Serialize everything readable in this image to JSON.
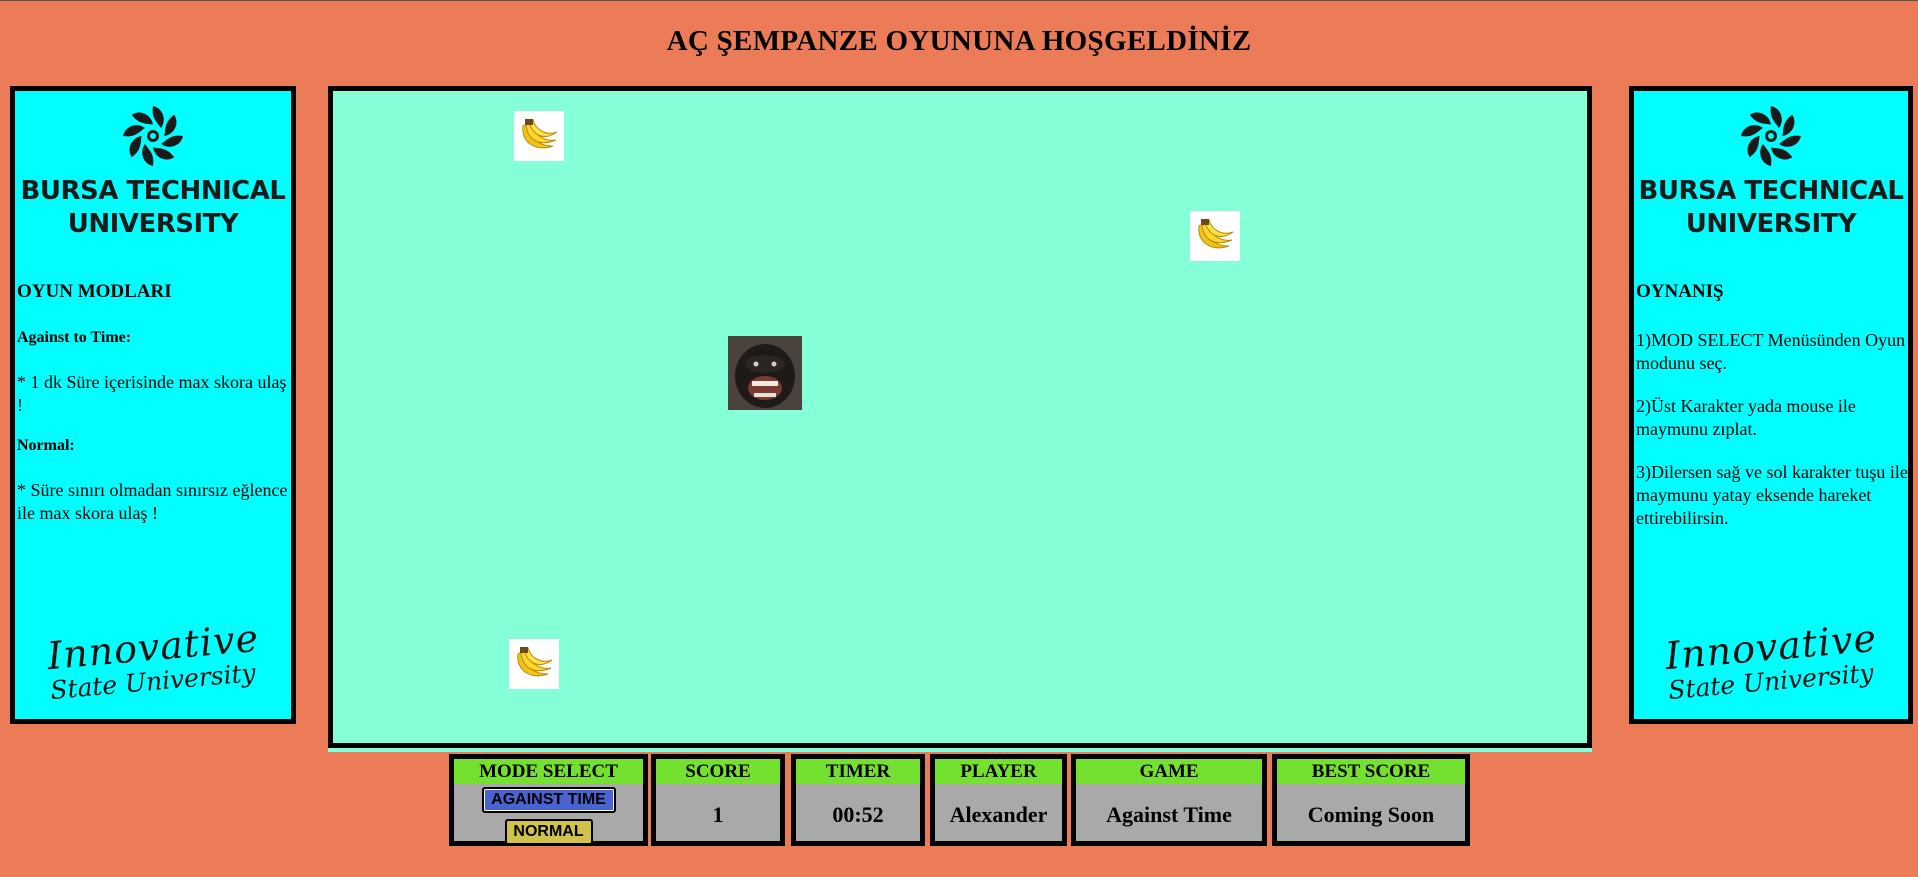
{
  "header": {
    "title": "AÇ ŞEMPANZE OYUNUNA HOŞGELDİNİZ"
  },
  "left_panel": {
    "university": "BURSA TECHNICAL UNIVERSITY",
    "heading": "OYUN MODLARI",
    "mode1_title": "Against to Time:",
    "mode1_desc": "* 1 dk Süre içerisinde max skora ulaş !",
    "mode2_title": "Normal:",
    "mode2_desc": "* Süre sınırı olmadan sınırsız eğlence ile max skora ulaş !",
    "motto_line1": "Innovative",
    "motto_line2": "State University"
  },
  "right_panel": {
    "university": "BURSA TECHNICAL UNIVERSITY",
    "heading": "OYNANIŞ",
    "step1": "1)MOD SELECT Menüsünden Oyun modunu seç.",
    "step2": "2)Üst Karakter yada mouse ile maymunu zıplat.",
    "step3": "3)Dilersen sağ ve sol karakter tuşu ile maymunu yatay eksende hareket ettirebilirsin.",
    "motto_line1": "Innovative",
    "motto_line2": "State University"
  },
  "game": {
    "icons": {
      "banana": "banana-icon",
      "chimp": "chimpanzee-sprite"
    },
    "background_color": "#84ffd7"
  },
  "hud": {
    "mode_select": {
      "label": "MODE SELECT",
      "btn_time": "AGAINST TIME",
      "btn_normal": "NORMAL"
    },
    "score": {
      "label": "SCORE",
      "value": "1"
    },
    "timer": {
      "label": "TIMER",
      "value": "00:52"
    },
    "player": {
      "label": "PLAYER",
      "value": "Alexander"
    },
    "game": {
      "label": "GAME",
      "value": "Against Time"
    },
    "best": {
      "label": "BEST SCORE",
      "value": "Coming Soon"
    }
  },
  "colors": {
    "page_bg": "#ec7b58",
    "panel_bg": "#00ffff",
    "hud_header": "#74e030",
    "hud_bg": "#a9a9a9",
    "btn_time": "#4b63d1",
    "btn_normal": "#d1c24b"
  }
}
